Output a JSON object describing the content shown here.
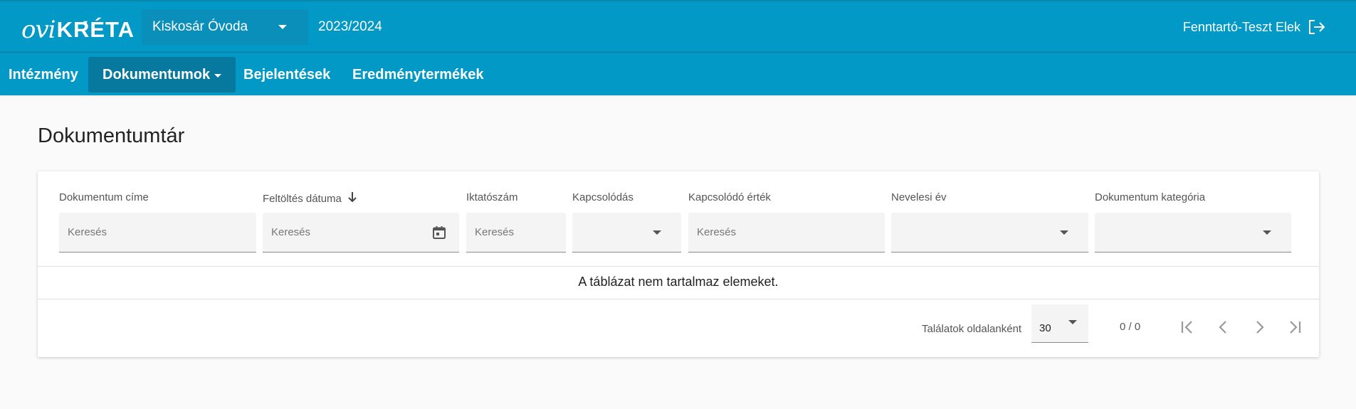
{
  "header": {
    "logo_ovi": "ovi",
    "logo_kreta": "KRÉTA",
    "school": "Kiskosár Óvoda",
    "year": "2023/2024",
    "user": "Fenntartó-Teszt Elek"
  },
  "nav": {
    "items": [
      {
        "label": "Intézmény"
      },
      {
        "label": "Dokumentumok"
      },
      {
        "label": "Bejelentések"
      },
      {
        "label": "Eredménytermékek"
      }
    ]
  },
  "page": {
    "title": "Dokumentumtár"
  },
  "table": {
    "columns": [
      {
        "label": "Dokumentum címe",
        "placeholder": "Keresés"
      },
      {
        "label": "Feltöltés dátuma",
        "placeholder": "Keresés"
      },
      {
        "label": "Iktatószám",
        "placeholder": "Keresés"
      },
      {
        "label": "Kapcsolódás",
        "placeholder": ""
      },
      {
        "label": "Kapcsolódó érték",
        "placeholder": "Keresés"
      },
      {
        "label": "Nevelesi év",
        "placeholder": ""
      },
      {
        "label": "Dokumentum kategória",
        "placeholder": ""
      }
    ],
    "empty_message": "A táblázat nem tartalmaz elemeket."
  },
  "pagination": {
    "per_page_label": "Találatok oldalanként",
    "per_page": "30",
    "range": "0 / 0"
  },
  "colors": {
    "primary": "#0299c6",
    "active_nav": "#07789e"
  }
}
